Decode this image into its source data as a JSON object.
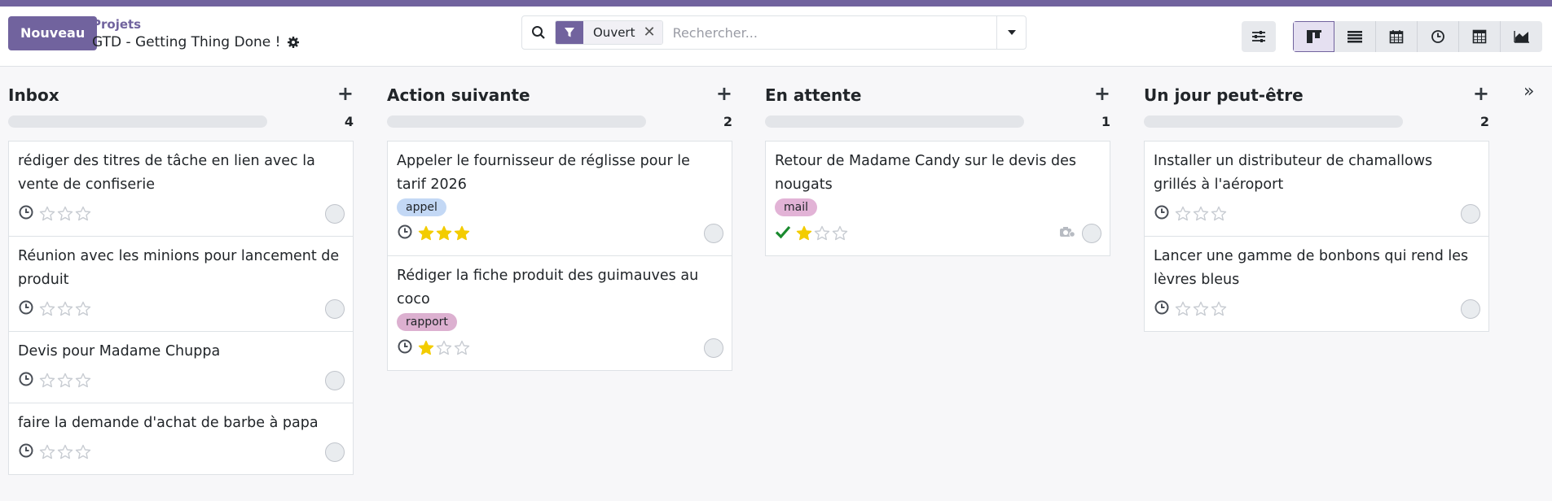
{
  "header": {
    "new_button": "Nouveau",
    "breadcrumb_parent": "Projets",
    "breadcrumb_current": "GTD - Getting Thing Done !",
    "accent_color": "#71639e"
  },
  "search": {
    "facet_value": "Ouvert",
    "facet_close": "✕",
    "placeholder": "Rechercher..."
  },
  "view_switcher": {
    "active": "kanban",
    "views": [
      "kanban",
      "list",
      "calendar",
      "activity",
      "pivot",
      "graph"
    ]
  },
  "columns": [
    {
      "title": "Inbox",
      "add": "+",
      "count": "4",
      "cards": [
        {
          "title": "rédiger des titres de tâche en lien avec la vente de confiserie",
          "tag": "",
          "tag_color": "",
          "stars": 0,
          "status": "clock"
        },
        {
          "title": "Réunion avec les minions pour lancement de produit",
          "tag": "",
          "tag_color": "",
          "stars": 0,
          "status": "clock"
        },
        {
          "title": "Devis pour Madame Chuppa",
          "tag": "",
          "tag_color": "",
          "stars": 0,
          "status": "clock"
        },
        {
          "title": "faire la demande d'achat de barbe à papa",
          "tag": "",
          "tag_color": "",
          "stars": 0,
          "status": "clock"
        }
      ]
    },
    {
      "title": "Action suivante",
      "add": "+",
      "count": "2",
      "cards": [
        {
          "title": "Appeler le fournisseur de réglisse pour le tarif 2026",
          "tag": "appel",
          "tag_color": "#c3d8f5",
          "stars": 3,
          "status": "clock"
        },
        {
          "title": "Rédiger la fiche produit des guimauves au coco",
          "tag": "rapport",
          "tag_color": "#dcb0d0",
          "stars": 1,
          "status": "clock"
        }
      ]
    },
    {
      "title": "En attente",
      "add": "+",
      "count": "1",
      "cards": [
        {
          "title": "Retour de Madame Candy sur le devis des nougats",
          "tag": "mail",
          "tag_color": "#e2b3d6",
          "stars": 1,
          "status": "check",
          "camera": true
        }
      ]
    },
    {
      "title": "Un jour peut-être",
      "add": "+",
      "count": "2",
      "cards": [
        {
          "title": "Installer un distributeur de chamallows grillés à l'aéroport",
          "tag": "",
          "tag_color": "",
          "stars": 0,
          "status": "clock"
        },
        {
          "title": "Lancer une gamme de bonbons qui rend les lèvres bleus",
          "tag": "",
          "tag_color": "",
          "stars": 0,
          "status": "clock"
        }
      ]
    }
  ],
  "collapse_label": "»",
  "colors": {
    "star_filled": "#f3cc00",
    "star_empty": "#c8ccd2",
    "check": "#1a8a2e"
  }
}
